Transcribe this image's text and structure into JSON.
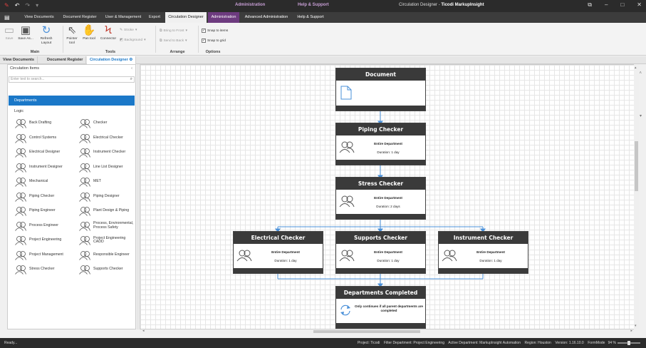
{
  "app": {
    "title_prefix": "Circulation Designer - ",
    "title_app": "Ticodi MarkupInsight",
    "context_groups": [
      "Administration",
      "Help & Support"
    ]
  },
  "window_controls": {
    "restore": "⧉",
    "minimize": "–",
    "maximize": "□",
    "close": "✕"
  },
  "tabs": [
    {
      "label": "View Documents"
    },
    {
      "label": "Document Register"
    },
    {
      "label": "User & Management"
    },
    {
      "label": "Export"
    },
    {
      "label": "Circulation Designer"
    },
    {
      "label": "Administration"
    },
    {
      "label": "Advanced Administration"
    },
    {
      "label": "Help & Support"
    }
  ],
  "ribbon": {
    "groups": [
      "Main",
      "Tools",
      "Arrange",
      "Options"
    ],
    "main": [
      {
        "label": "Save",
        "icon": "save-icon"
      },
      {
        "label": "Save As...",
        "icon": "save-as-icon"
      },
      {
        "label": "Refresh Layout",
        "icon": "refresh-icon"
      }
    ],
    "tools": [
      {
        "label": "Pointer tool",
        "icon": "pointer-icon"
      },
      {
        "label": "Pan tool",
        "icon": "hand-icon"
      },
      {
        "label": "Connector",
        "icon": "connector-icon"
      }
    ],
    "stroke": "Stroke",
    "background": "Background",
    "arrange": {
      "bring_front": "Bring to Front",
      "send_back": "Send to Back"
    },
    "options": {
      "snap_items": "Snap to items",
      "snap_grid": "Snap to grid",
      "snap_items_checked": true,
      "snap_grid_checked": true
    }
  },
  "doc_tabs": [
    "View Documents",
    "Document Register",
    "Circulation Designer"
  ],
  "left": {
    "header": "Circulation Items",
    "search_placeholder": "Enter text to search...",
    "departments": "Departments",
    "logic": "Logic",
    "items": [
      "Back Drafting",
      "Checker",
      "Control Systems",
      "Electrical Checker",
      "Electrical Designer",
      "Instrument Checker",
      "Instrument Designer",
      "Line List Designer",
      "Mechanical",
      "MET",
      "Piping Checker",
      "Piping Designer",
      "Piping Engineer",
      "Plant Design & Piping",
      "Process Engineer",
      "Process, Environmental, Process Safety",
      "Project Engineering",
      "Project Engineering CADD",
      "Project Management",
      "Responsible Engineer",
      "Stress Checker",
      "Supports Checker"
    ]
  },
  "flow": {
    "document": {
      "title": "Document"
    },
    "piping": {
      "title": "Piping Checker",
      "scope": "Entire Department",
      "duration": "Duration: 1 day"
    },
    "stress": {
      "title": "Stress Checker",
      "scope": "Entire Department",
      "duration": "Duration: 2 days"
    },
    "electrical": {
      "title": "Electrical Checker",
      "scope": "Entire Department",
      "duration": "Duration: 1 day"
    },
    "supports": {
      "title": "Supports Checker",
      "scope": "Entire Department",
      "duration": "Duration: 1 day"
    },
    "instrument": {
      "title": "Instrument Checker",
      "scope": "Entire Department",
      "duration": "Duration: 1 day"
    },
    "completed": {
      "title": "Departments Completed",
      "note": "Only continues if all parent departments are completed"
    }
  },
  "status": {
    "ready": "Ready...",
    "project": "Project: Ticodi",
    "filter": "Filter Department: Project Engineering",
    "active": "Active Department: MarkupInsight Automation",
    "region": "Region: Houston",
    "version": "Version: 1.16.10.0",
    "formmode": "FormMode",
    "zoom": "94 %"
  },
  "colors": {
    "accent": "#1b78c8",
    "node_header": "#3a3a3a",
    "context_tab": "#6d3b7f",
    "connector": "#4a90d9"
  }
}
